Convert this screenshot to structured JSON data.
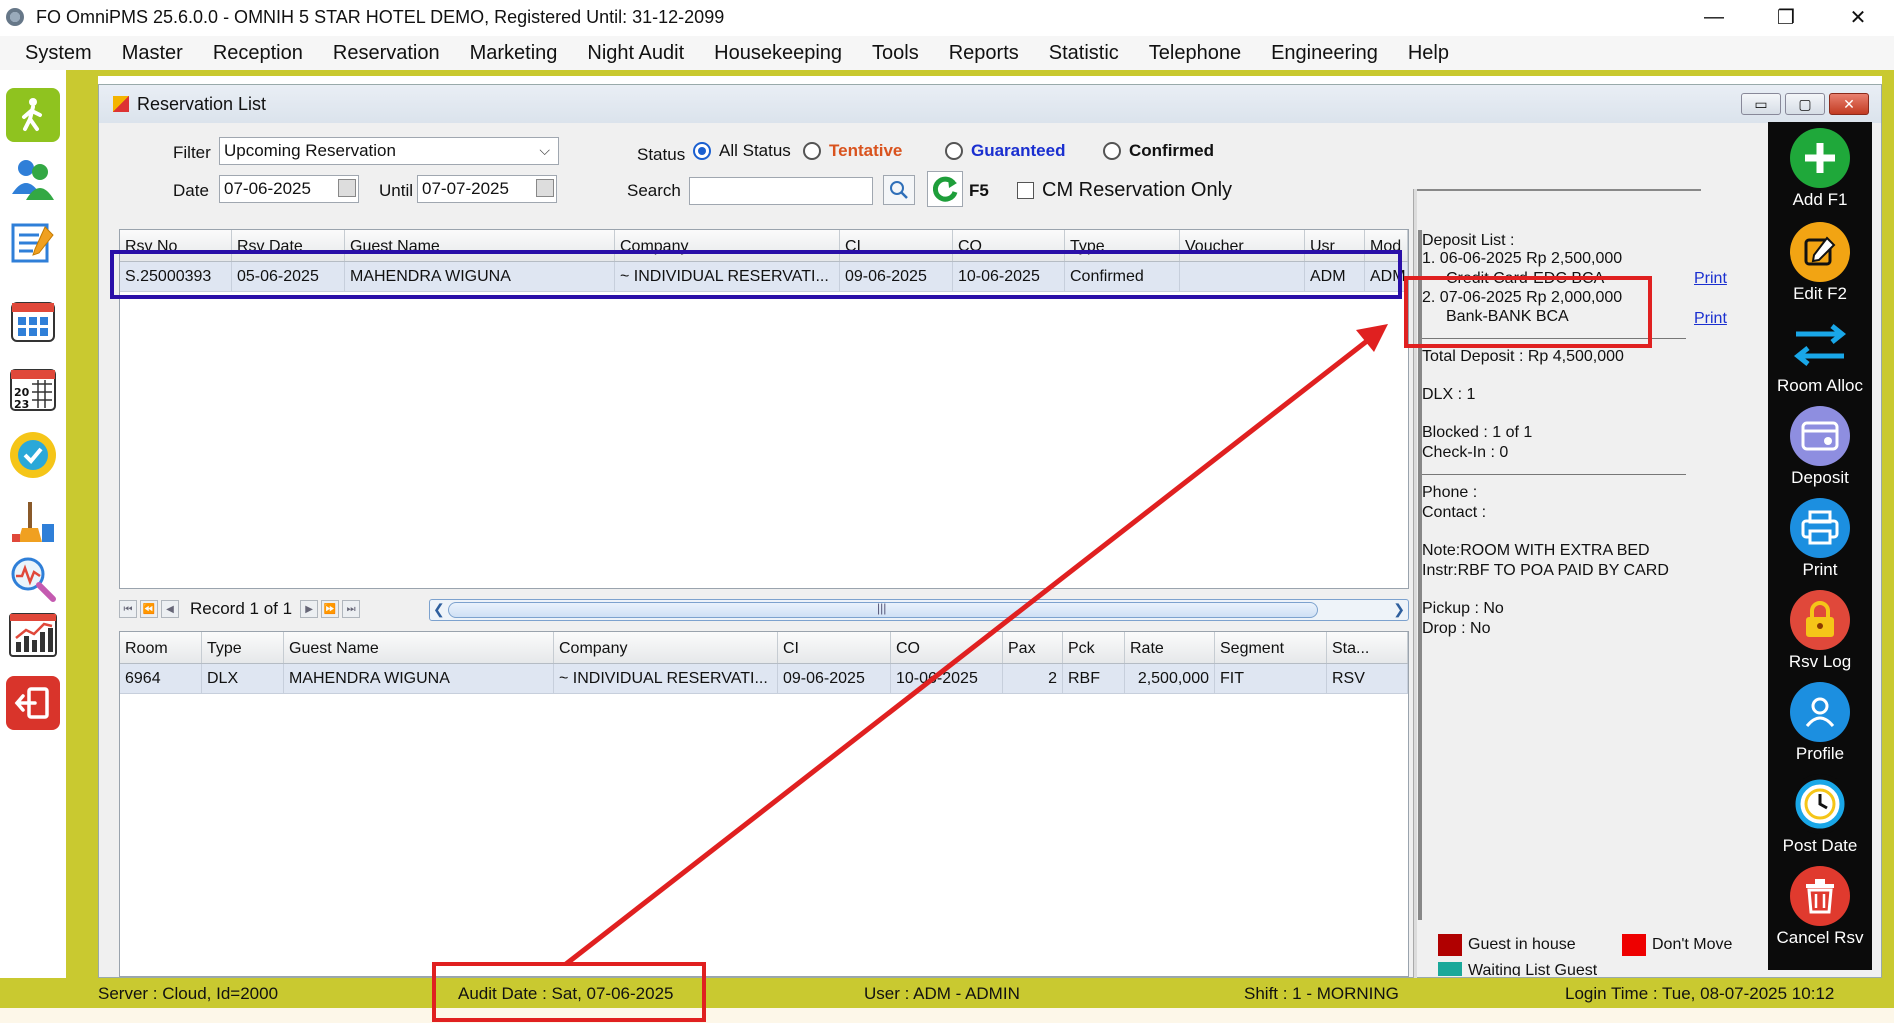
{
  "app": {
    "title": "FO OmniPMS 25.6.0.0 - OMNIH 5 STAR HOTEL DEMO, Registered Until: 31-12-2099",
    "window_controls": [
      "—",
      "❐",
      "✕"
    ]
  },
  "menu": [
    "System",
    "Master",
    "Reception",
    "Reservation",
    "Marketing",
    "Night Audit",
    "Housekeeping",
    "Tools",
    "Reports",
    "Statistic",
    "Telephone",
    "Engineering",
    "Help"
  ],
  "window": {
    "title": "Reservation List",
    "controls": [
      "▭",
      "▢",
      "✕"
    ]
  },
  "filter": {
    "filter_label": "Filter",
    "filter_value": "Upcoming Reservation",
    "date_label": "Date",
    "date_value": "07-06-2025",
    "until_label": "Until",
    "until_value": "07-07-2025",
    "status_label": "Status",
    "status_options": [
      {
        "label": "All Status",
        "selected": true,
        "color": "#111111"
      },
      {
        "label": "Tentative",
        "selected": false,
        "color": "#d9531e"
      },
      {
        "label": "Guaranteed",
        "selected": false,
        "color": "#1a2fd0"
      },
      {
        "label": "Confirmed",
        "selected": false,
        "color": "#111111"
      }
    ],
    "search_label": "Search",
    "search_value": "",
    "refresh_label": "F5",
    "cm_only_label": "CM Reservation Only"
  },
  "reservations": {
    "columns": [
      "Rsv No",
      "Rsv Date",
      "Guest Name",
      "Company",
      "CI",
      "CO",
      "Type",
      "Voucher",
      "Usr",
      "Mod"
    ],
    "rows": [
      [
        "S.25000393",
        "05-06-2025",
        "MAHENDRA WIGUNA",
        "~ INDIVIDUAL RESERVATI...",
        "09-06-2025",
        "10-06-2025",
        "Confirmed",
        "",
        "ADM",
        "ADM"
      ]
    ]
  },
  "navigator": {
    "record_text": "Record 1 of 1",
    "scroll_grip": "|||"
  },
  "rooms": {
    "columns": [
      "Room",
      "Type",
      "Guest Name",
      "Company",
      "CI",
      "CO",
      "Pax",
      "Pck",
      "Rate",
      "Segment",
      "Sta..."
    ],
    "rows": [
      [
        "6964",
        "DLX",
        "MAHENDRA WIGUNA",
        "~ INDIVIDUAL RESERVATI...",
        "09-06-2025",
        "10-06-2025",
        "2",
        "RBF",
        "2,500,000",
        "FIT",
        "RSV"
      ]
    ]
  },
  "info": {
    "deposit_title": "Deposit List :",
    "deposit_1": "1. 06-06-2025   Rp 2,500,000",
    "deposit_1_method": "Credit Card-EDC BCA",
    "deposit_2": "2. 07-06-2025   Rp 2,000,000",
    "deposit_2_method": "Bank-BANK BCA",
    "print_label": "Print",
    "total_deposit": "Total Deposit : Rp 4,500,000",
    "room_type_count": "DLX : 1",
    "blocked": "Blocked : 1 of 1",
    "checkin": "Check-In : 0",
    "phone": "Phone :",
    "contact": "Contact :",
    "note": "Note:ROOM WITH EXTRA BED",
    "instr": "Instr:RBF TO POA PAID BY CARD",
    "pickup": "Pickup : No",
    "drop": "Drop : No",
    "legend_guest_in_house": "Guest in house",
    "legend_dont_move": "Don't Move",
    "legend_waiting": "Waiting List Guest",
    "legend_colors": {
      "guest_in_house": "#b00000",
      "dont_move": "#ee0000",
      "waiting": "#1aa89a"
    }
  },
  "actions": [
    {
      "label": "Add F1",
      "icon": "add-icon",
      "glyph": "+",
      "color": "#1fa83a"
    },
    {
      "label": "Edit F2",
      "icon": "edit-icon",
      "glyph": "✎",
      "color": "#f2a413"
    },
    {
      "label": "Room Alloc",
      "icon": "room-alloc-icon",
      "glyph": "⇄",
      "color": "#0b0b0b"
    },
    {
      "label": "Deposit",
      "icon": "deposit-icon",
      "glyph": "▤",
      "color": "#7b7bd9"
    },
    {
      "label": "Print",
      "icon": "print-icon",
      "glyph": "⎙",
      "color": "#1c8fe0"
    },
    {
      "label": "Rsv Log",
      "icon": "lock-icon",
      "glyph": "🔒",
      "color": "#e0483a"
    },
    {
      "label": "Profile",
      "icon": "profile-icon",
      "glyph": "☺",
      "color": "#1c8fe0"
    },
    {
      "label": "Post Date",
      "icon": "clock-icon",
      "glyph": "◷",
      "color": "#0b0b0b"
    },
    {
      "label": "Cancel Rsv",
      "icon": "trash-icon",
      "glyph": "🗑",
      "color": "#e03a2e"
    }
  ],
  "statusbar": {
    "server": "Server : Cloud, Id=2000",
    "audit_date": "Audit Date : Sat, 07-06-2025",
    "user": "User : ADM - ADMIN",
    "shift": "Shift : 1 - MORNING",
    "login_time": "Login Time : Tue, 08-07-2025 10:12"
  },
  "annotation_colors": {
    "highlight_row": "#2a0fa8",
    "arrow": "#e02020"
  }
}
